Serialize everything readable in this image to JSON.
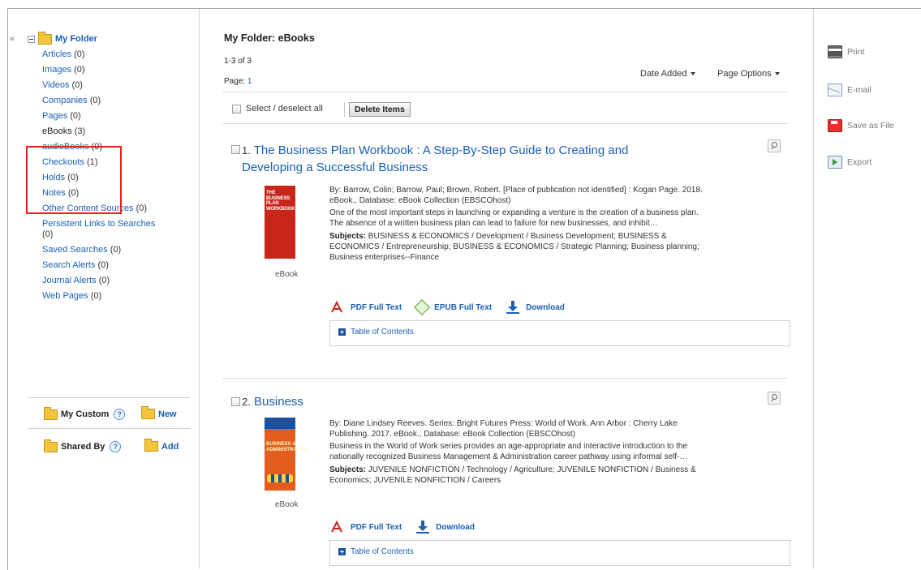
{
  "sidebar": {
    "collapse_glyph": "«",
    "root_label": "My Folder",
    "items": [
      {
        "label": "Articles",
        "count": "(0)"
      },
      {
        "label": "Images",
        "count": "(0)"
      },
      {
        "label": "Videos",
        "count": "(0)"
      },
      {
        "label": "Companies",
        "count": "(0)"
      },
      {
        "label": "Pages",
        "count": "(0)"
      },
      {
        "label": "eBooks",
        "count": "(3)"
      },
      {
        "label": "audioBooks",
        "count": "(0)"
      },
      {
        "label": "Checkouts",
        "count": "(1)"
      },
      {
        "label": "Holds",
        "count": "(0)"
      },
      {
        "label": "Notes",
        "count": "(0)"
      },
      {
        "label": "Other Content Sources",
        "count": "(0)"
      },
      {
        "label": "Persistent Links to Searches",
        "count": "(0)"
      },
      {
        "label": "Saved Searches",
        "count": "(0)"
      },
      {
        "label": "Search Alerts",
        "count": "(0)"
      },
      {
        "label": "Journal Alerts",
        "count": "(0)"
      },
      {
        "label": "Web Pages",
        "count": "(0)"
      }
    ],
    "my_custom_label": "My Custom",
    "new_label": "New",
    "shared_by_label": "Shared By",
    "add_label": "Add",
    "help_glyph": "?"
  },
  "main": {
    "title": "My Folder: eBooks",
    "range": "1-3 of 3",
    "page_label": "Page:",
    "page_number": "1",
    "sort_label": "Date Added",
    "page_options_label": "Page Options",
    "select_all_label": "Select / deselect all",
    "delete_label": "Delete Items",
    "results": [
      {
        "number": "1.",
        "title_line1": "The Business Plan Workbook : A Step-By-Step Guide to Creating and",
        "title_line2": "Developing a Successful Business",
        "cover_text": "THE BUSINESS PLAN WORKBOOK",
        "format": "eBook",
        "byline_1": "By: Barrow, Colin; Barrow, Paul; Brown, Robert. [Place of publication not identified] : Kogan Page. 2018.",
        "byline_2": "eBook., Database: eBook Collection (EBSCOhost)",
        "abstract_1": "One of the most important steps in launching or expanding a venture is the creation of a business plan.",
        "abstract_2": "The absence of a written business plan can lead to failure for new businesses, and inhibit…",
        "subjects_label": "Subjects:",
        "subjects_1": "BUSINESS & ECONOMICS / Development / Business Development; BUSINESS &",
        "subjects_2": "ECONOMICS / Entrepreneurship; BUSINESS & ECONOMICS / Strategic Planning; Business planning;",
        "subjects_3": "Business enterprises--Finance",
        "pdf_label": "PDF Full Text",
        "epub_label": "EPUB Full Text",
        "download_label": "Download",
        "toc_label": "Table of Contents"
      },
      {
        "number": "2.",
        "title_line1": "Business",
        "cover_text": "BUSINESS & ADMINISTRATION",
        "format": "eBook",
        "byline_1": "By: Diane Lindsey Reeves. Series: Bright Futures Press: World of Work. Ann Arbor : Cherry Lake",
        "byline_2": "Publishing. 2017. eBook., Database: eBook Collection (EBSCOhost)",
        "abstract_1": "Business in the World of Work series provides an age-appropriate and interactive introduction to the",
        "abstract_2": "nationally recognized Business Management & Administration career pathway using informal self-…",
        "subjects_label": "Subjects:",
        "subjects_1": "JUVENILE NONFICTION / Technology / Agriculture; JUVENILE NONFICTION / Business &",
        "subjects_2": "Economics; JUVENILE NONFICTION / Careers",
        "pdf_label": "PDF Full Text",
        "download_label": "Download",
        "toc_label": "Table of Contents"
      }
    ]
  },
  "tools": {
    "print": "Print",
    "email": "E-mail",
    "save": "Save as File",
    "export": "Export"
  }
}
